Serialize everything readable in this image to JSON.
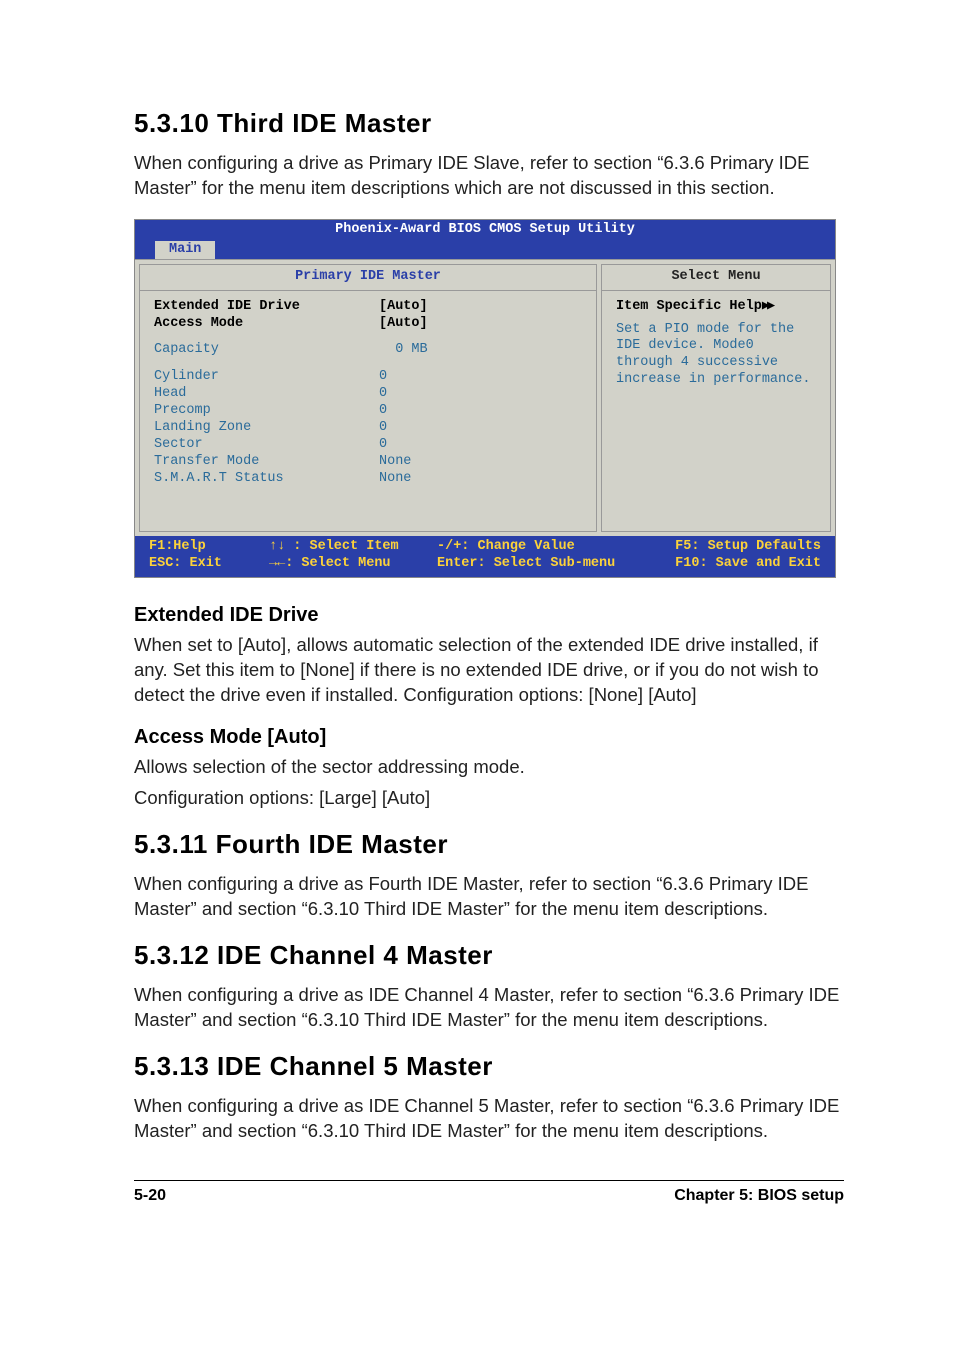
{
  "sections": {
    "s1": {
      "num": "5.3.10",
      "title": "Third IDE Master",
      "para": "When configuring a drive as Primary IDE Slave, refer to section “6.3.6 Primary IDE Master” for the menu item descriptions which are not discussed in this section."
    },
    "ext": {
      "title": "Extended IDE Drive",
      "para": "When set to [Auto], allows automatic selection of the extended IDE drive installed, if any. Set this item to [None] if there is no extended IDE drive, or if you do not wish to detect the drive even if installed. Configuration options: [None] [Auto]"
    },
    "acc": {
      "title": "Access Mode [Auto]",
      "para1": "Allows selection of the sector addressing mode.",
      "para2": "Configuration options:  [Large] [Auto]"
    },
    "s2": {
      "num": "5.3.11",
      "title": "Fourth IDE Master",
      "para": "When configuring a drive as Fourth IDE Master, refer to section “6.3.6 Primary IDE Master” and section “6.3.10 Third IDE Master” for the menu item descriptions."
    },
    "s3": {
      "num": "5.3.12",
      "title": "IDE Channel 4 Master",
      "para": "When configuring a drive as IDE Channel 4 Master, refer to section “6.3.6 Primary IDE Master” and section “6.3.10 Third IDE Master” for the menu item descriptions."
    },
    "s4": {
      "num": "5.3.13",
      "title": "IDE Channel 5 Master",
      "para": "When configuring a drive as IDE Channel 5 Master, refer to section “6.3.6 Primary IDE Master” and section “6.3.10 Third IDE Master” for the menu item descriptions."
    }
  },
  "bios": {
    "title": "Phoenix-Award BIOS CMOS Setup Utility",
    "tab": "Main",
    "left_header": "Primary IDE Master",
    "right_header": "Select Menu",
    "fields": {
      "ext_label": "Extended IDE Drive",
      "ext_value": "[Auto]",
      "acc_label": "Access Mode",
      "acc_value": "[Auto]",
      "cap_label": "Capacity",
      "cap_value": "  0 MB",
      "cyl_label": "Cylinder",
      "cyl_value": "0",
      "head_label": "Head",
      "head_value": "0",
      "pre_label": "Precomp",
      "pre_value": "0",
      "lz_label": "Landing Zone",
      "lz_value": "0",
      "sec_label": "Sector",
      "sec_value": "0",
      "tm_label": "Transfer Mode",
      "tm_value": "None",
      "smart_label": "S.M.A.R.T Status",
      "smart_value": "None"
    },
    "help": {
      "title": "Item Specific Help",
      "body": "Set a PIO mode for the IDE device. Mode0 through 4 successive increase in performance."
    },
    "footer": {
      "r1c1": "F1:Help",
      "r1c2": "↑↓ : Select Item",
      "r1c3": "-/+: Change Value",
      "r1c4": "F5: Setup Defaults",
      "r2c1": "ESC: Exit",
      "r2c2": "→←: Select Menu",
      "r2c3": "Enter: Select Sub-menu",
      "r2c4": "F10: Save and Exit"
    }
  },
  "footer": {
    "left": "5-20",
    "right": "Chapter 5: BIOS setup"
  }
}
